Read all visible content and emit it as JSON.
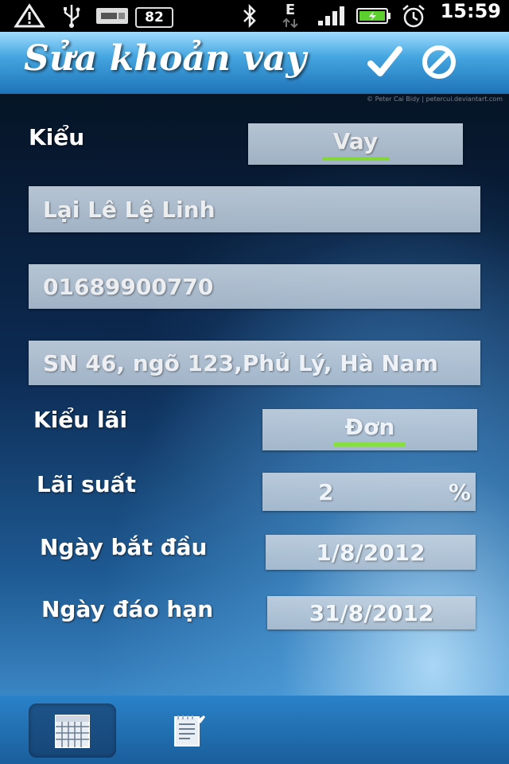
{
  "status_bar": {
    "battery_badge": "82",
    "network_type": "E",
    "time": "15:59",
    "icons": [
      "warning-icon",
      "usb-icon",
      "usb-storage-icon",
      "bluetooth-icon",
      "edge-data-icon",
      "signal-icon",
      "battery-icon",
      "alarm-icon"
    ]
  },
  "header": {
    "title": "Sửa khoản vay",
    "confirm_icon": "checkmark-icon",
    "cancel_icon": "cancel-icon"
  },
  "watermark": "© Peter Cai Bidy | petercui.deviantart.com",
  "form": {
    "type_label": "Kiểu",
    "type_value": "Vay",
    "name_value": "Lại Lê Lệ Linh",
    "phone_value": "01689900770",
    "address_value": "SN 46, ngõ 123,Phủ Lý, Hà Nam",
    "interest_type_label": "Kiểu lãi",
    "interest_type_value": "Đơn",
    "rate_label": "Lãi suất",
    "rate_value": "2",
    "rate_unit": "%",
    "start_label": "Ngày bắt đầu",
    "start_value": "1/8/2012",
    "due_label": "Ngày đáo hạn",
    "due_value": "31/8/2012"
  },
  "bottom_bar": {
    "tabs": [
      {
        "icon": "calendar-icon",
        "active": true
      },
      {
        "icon": "notes-icon",
        "active": false
      }
    ]
  },
  "colors": {
    "accent_underline": "#8ee83a",
    "title_bar": "#45a6e0"
  }
}
